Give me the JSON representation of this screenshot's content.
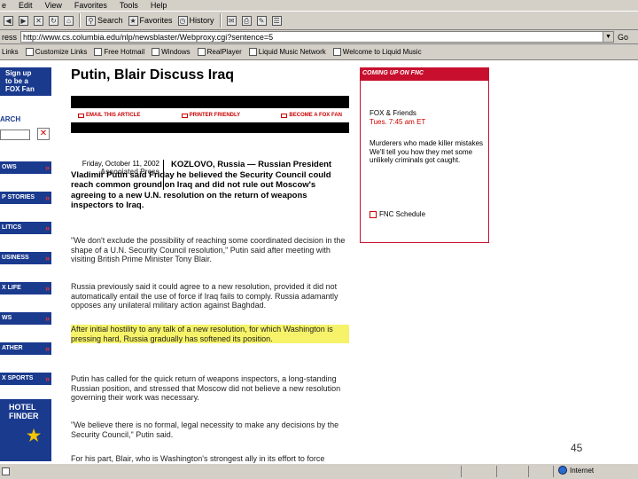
{
  "menu": [
    "e",
    "Edit",
    "View",
    "Favorites",
    "Tools",
    "Help"
  ],
  "toolbar": {
    "search": "Search",
    "favorites": "Favorites",
    "history": "History"
  },
  "address": {
    "label": "ress",
    "url": "http://www.cs.columbia.edu/nlp/newsblaster/Webproxy.cgi?sentence=5",
    "go": "Go",
    "links_label": "Links"
  },
  "links": [
    "Customize Links",
    "Free Hotmail",
    "Windows",
    "RealPlayer",
    "Liquid Music Network",
    "Welcome to Liquid Music"
  ],
  "leftnav": {
    "fan_lines": [
      "Sign up",
      "to be a",
      "FOX Fan"
    ],
    "search_label": "ARCH",
    "buttons": [
      "OWS",
      "P STORIES",
      "LITICS",
      "USINESS",
      "X LIFE",
      "WS",
      "ATHER",
      "X SPORTS"
    ],
    "hotel_lines": [
      "HOTEL",
      "FINDER"
    ]
  },
  "article": {
    "headline": "Putin, Blair Discuss Iraq",
    "actions": [
      "EMAIL THIS ARTICLE",
      "PRINTER FRIENDLY",
      "BECOME A FOX FAN"
    ],
    "date": "Friday, October 11, 2002",
    "source": "Associated Press",
    "lead": "KOZLOVO, Russia — Russian President Vladimir Putin said Friday he believed the Security Council could reach common ground on Iraq and did not rule out Moscow's agreeing to a new U.N. resolution on the return of weapons inspectors to Iraq.",
    "paragraphs": [
      "\"We don't exclude the possibility of reaching some coordinated decision in the shape of a U.N. Security Council resolution,\" Putin said after meeting with visiting British Prime Minister Tony Blair.",
      "Russia previously said it could agree to a new resolution, provided it did not automatically entail the use of force if Iraq fails to comply. Russia adamantly opposes any unilateral military action against Baghdad.",
      "After initial hostility to any talk of a new resolution, for which Washington is pressing hard, Russia gradually has softened its position.",
      "Putin has called for the quick return of weapons inspectors, a long-standing Russian position, and stressed that Moscow did not believe a new resolution governing their work was necessary.",
      "\"We believe there is no formal, legal necessity to make any decisions by the Security Council,\" Putin said.",
      "For his part, Blair, who is Washington's strongest ally in its effort to force"
    ]
  },
  "fnc": {
    "header": "COMING UP ON FNC",
    "show1_title": "FOX & Friends",
    "show1_time": "Tues. 7:45 am ET",
    "show2_title": "Murderers who made killer mistakes",
    "show2_desc": "We'll tell you how they met some unlikely criminals got caught.",
    "schedule": "FNC Schedule"
  },
  "slide_number": "45",
  "status": {
    "zone": "Internet"
  },
  "colors": {
    "fox_blue": "#1a3a8e",
    "fox_red": "#c8102e",
    "highlight": "#f6f36a"
  }
}
